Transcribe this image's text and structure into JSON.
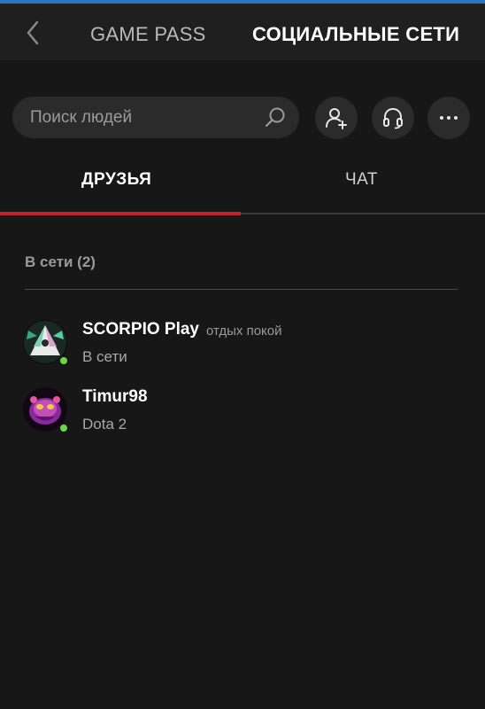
{
  "header": {
    "tabs": [
      {
        "label": "GAME PASS"
      },
      {
        "label": "СОЦИАЛЬНЫЕ СЕТИ"
      }
    ],
    "back_icon": "chevron-left-icon"
  },
  "search": {
    "placeholder": "Поиск людей",
    "icon": "search-icon"
  },
  "actions": {
    "add_friend_icon": "add-person-icon",
    "party_icon": "headset-icon",
    "more_icon": "more-dots-icon"
  },
  "subtabs": [
    {
      "label": "ДРУЗЬЯ",
      "active": true
    },
    {
      "label": "ЧАТ",
      "active": false
    }
  ],
  "friends_section": {
    "title": "В сети (2)",
    "items": [
      {
        "name": "SCORPIO Play",
        "tag": "отдых покой",
        "status": "В сети"
      },
      {
        "name": "Timur98",
        "tag": "",
        "status": "Dota 2"
      }
    ]
  },
  "colors": {
    "accent": "#c8202a",
    "online": "#6bd84a",
    "background": "#171717"
  }
}
